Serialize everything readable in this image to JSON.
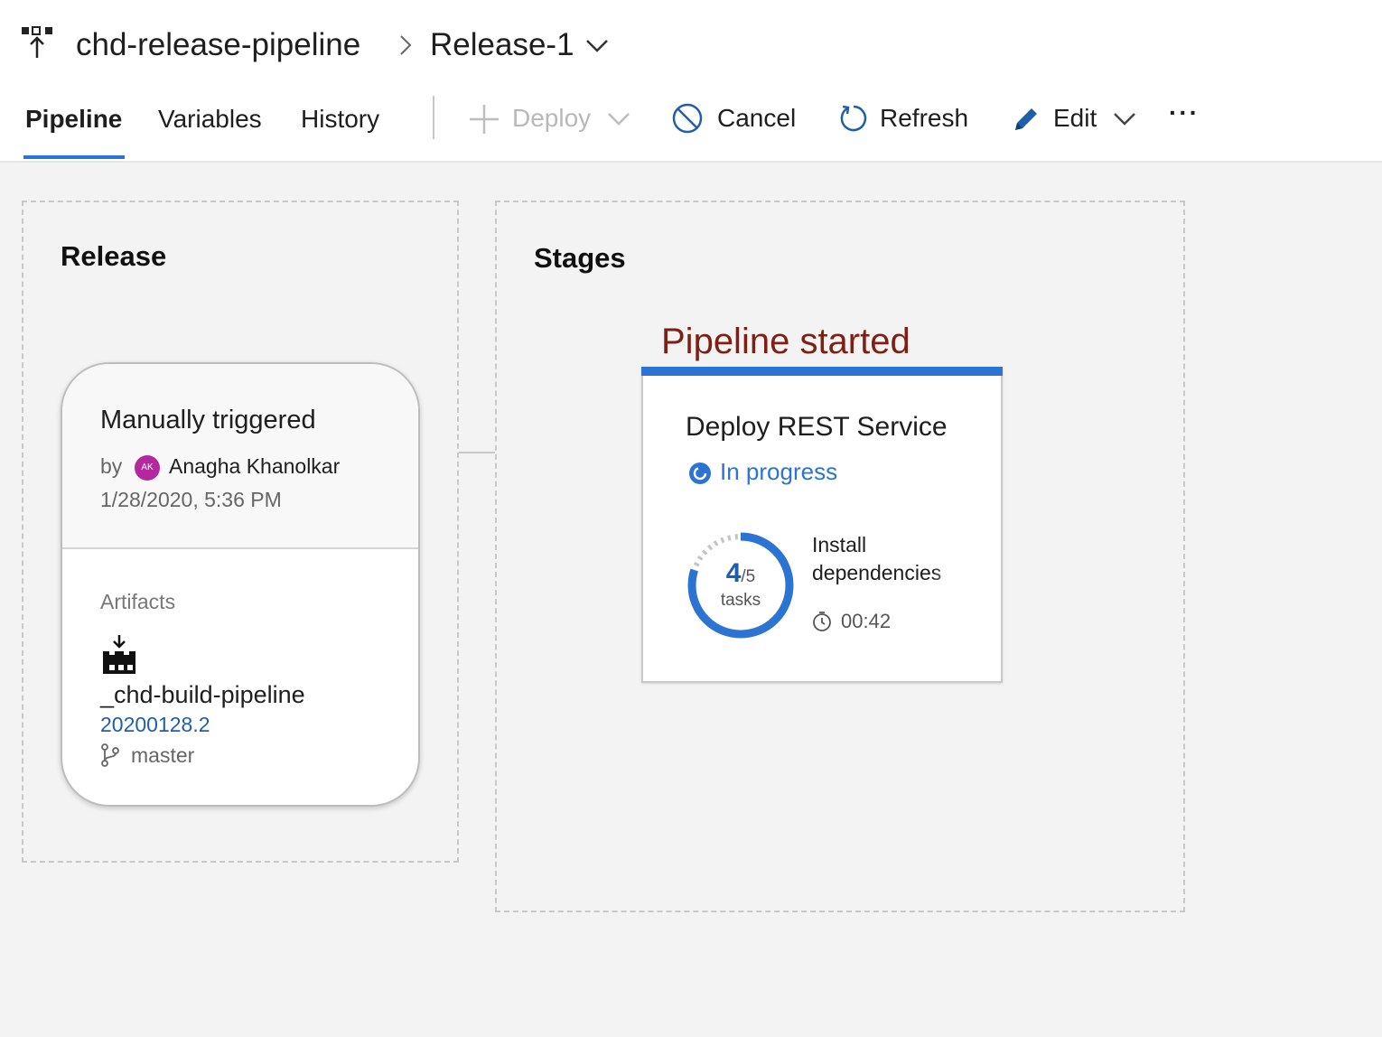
{
  "header": {
    "pipeline_name": "chd-release-pipeline",
    "release_name": "Release-1",
    "icon": "release-pipeline-icon"
  },
  "tabs": [
    {
      "label": "Pipeline",
      "active": true
    },
    {
      "label": "Variables",
      "active": false
    },
    {
      "label": "History",
      "active": false
    }
  ],
  "toolbar": {
    "deploy_label": "Deploy",
    "deploy_disabled": true,
    "cancel_label": "Cancel",
    "refresh_label": "Refresh",
    "edit_label": "Edit",
    "more_label": "···"
  },
  "release_panel": {
    "title": "Release",
    "trigger": "Manually triggered",
    "by_label": "by",
    "user_initials": "AK",
    "user_name": "Anagha Khanolkar",
    "date": "1/28/2020, 5:36 PM",
    "artifacts_label": "Artifacts",
    "artifact_name": "_chd-build-pipeline",
    "artifact_version": "20200128.2",
    "branch": "master"
  },
  "stages_panel": {
    "title": "Stages",
    "annotation": "Pipeline started",
    "stage": {
      "name": "Deploy REST Service",
      "status": "In progress",
      "tasks_done": "4",
      "tasks_total": "/5",
      "tasks_label": "tasks",
      "completed_fraction": 0.8,
      "current_task": "Install dependencies",
      "elapsed": "00:42"
    }
  },
  "colors": {
    "accent": "#2b74d4",
    "annotation": "#7e1f14",
    "avatar": "#b4289e",
    "link": "#1f5fa8"
  }
}
